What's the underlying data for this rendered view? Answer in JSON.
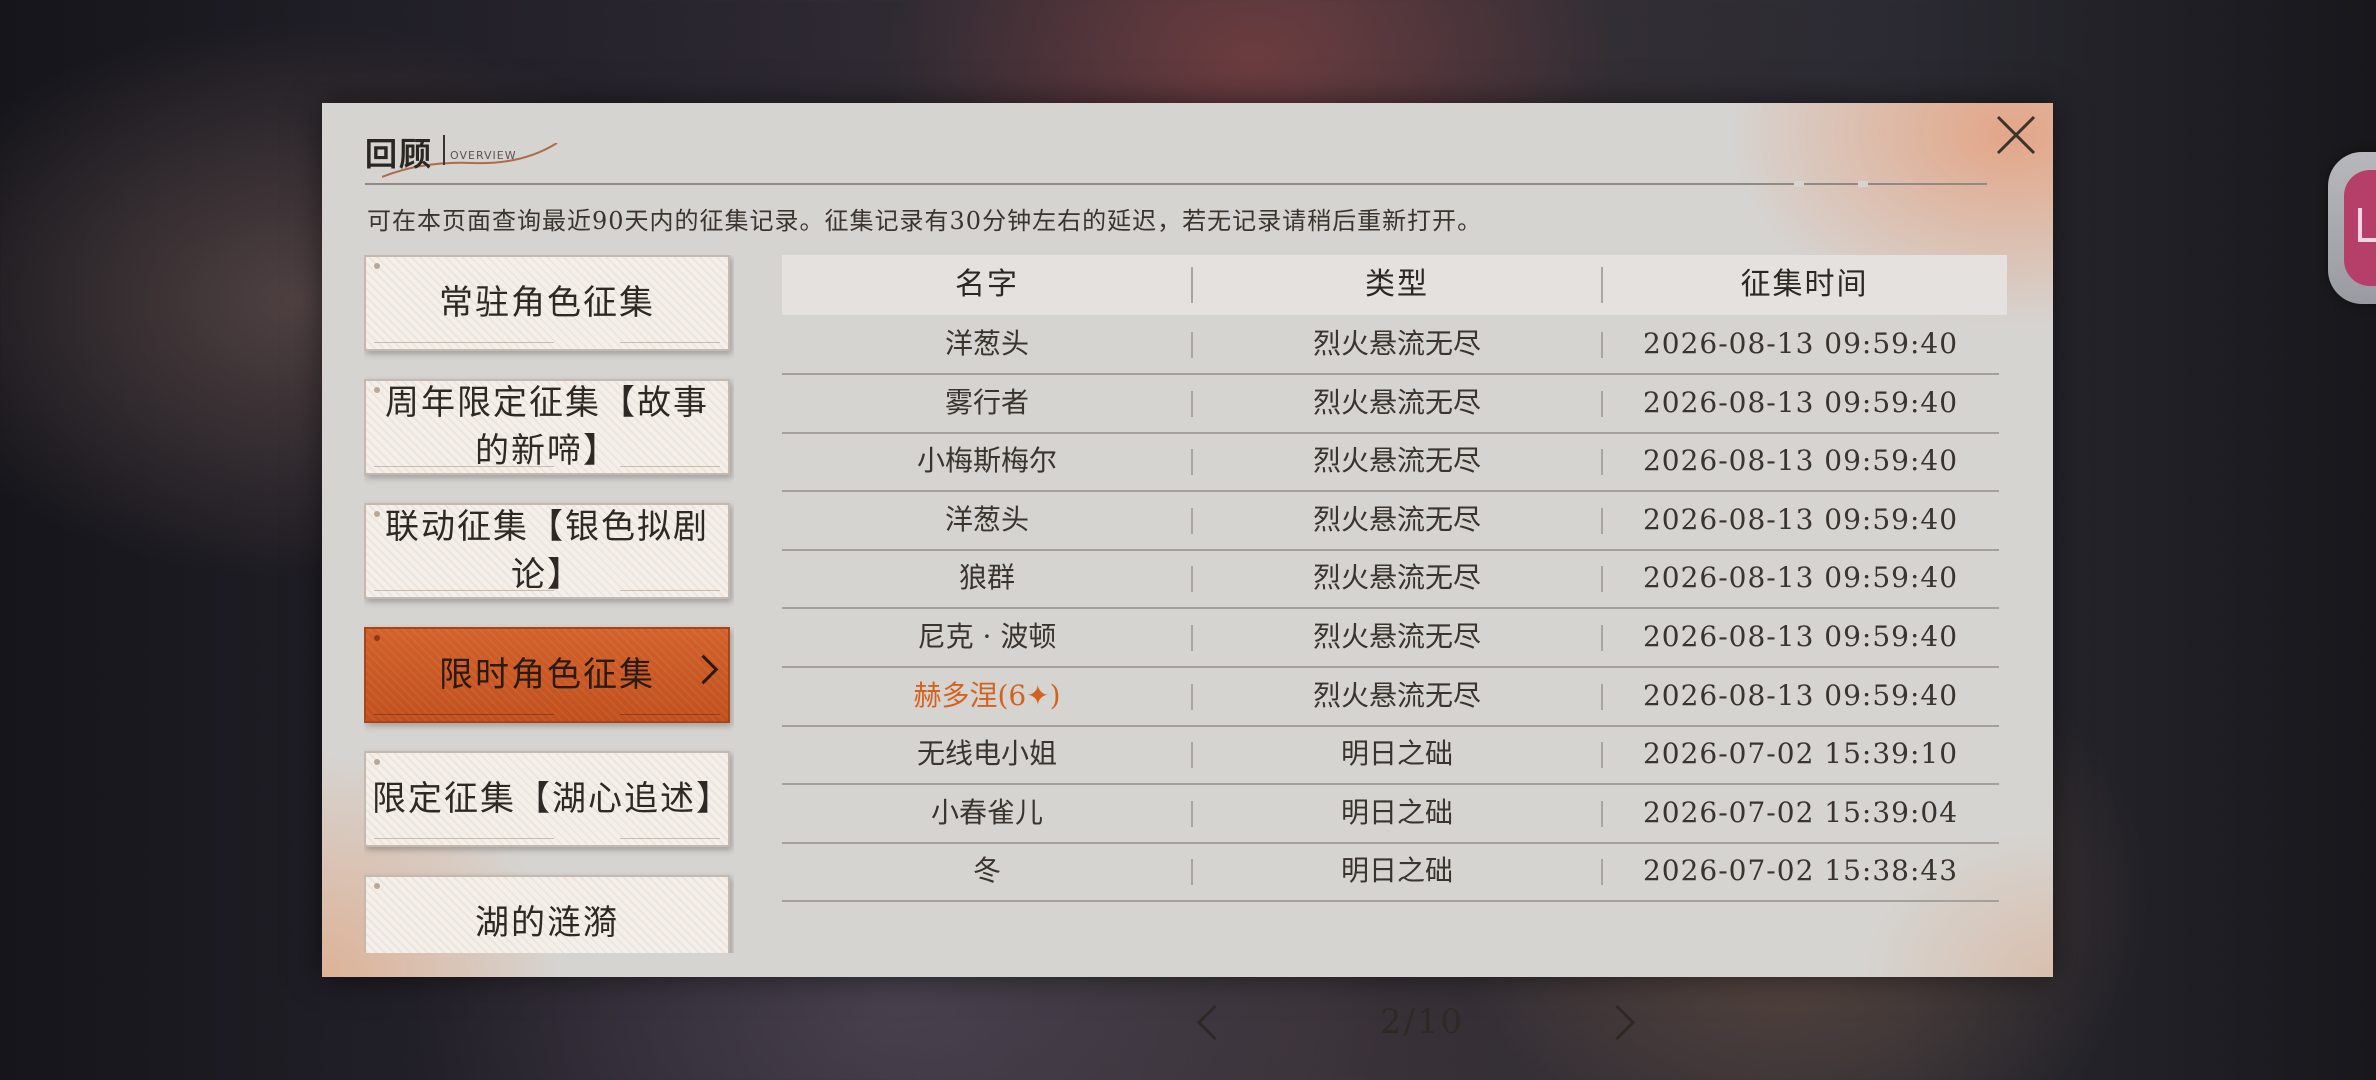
{
  "panel": {
    "title": "回顾",
    "title_sub": "OVERVIEW",
    "notice": "可在本页面查询最近90天内的征集记录。征集记录有30分钟左右的延迟，若无记录请稍后重新打开。"
  },
  "categories": [
    {
      "label": "常驻角色征集",
      "active": false
    },
    {
      "label": "周年限定征集【故事的新啼】",
      "active": false
    },
    {
      "label": "联动征集【银色拟剧论】",
      "active": false
    },
    {
      "label": "限时角色征集",
      "active": true
    },
    {
      "label": "限定征集【湖心追述】",
      "active": false
    },
    {
      "label": "湖的涟漪",
      "active": false
    }
  ],
  "table": {
    "headers": [
      "名字",
      "类型",
      "征集时间"
    ],
    "rows": [
      {
        "name": "洋葱头",
        "type": "烈火悬流无尽",
        "time": "2026-08-13 09:59:40"
      },
      {
        "name": "雾行者",
        "type": "烈火悬流无尽",
        "time": "2026-08-13 09:59:40"
      },
      {
        "name": "小梅斯梅尔",
        "type": "烈火悬流无尽",
        "time": "2026-08-13 09:59:40"
      },
      {
        "name": "洋葱头",
        "type": "烈火悬流无尽",
        "time": "2026-08-13 09:59:40"
      },
      {
        "name": "狼群",
        "type": "烈火悬流无尽",
        "time": "2026-08-13 09:59:40"
      },
      {
        "name": "尼克 · 波顿",
        "type": "烈火悬流无尽",
        "time": "2026-08-13 09:59:40"
      },
      {
        "name": "赫多涅(6✦)",
        "type": "烈火悬流无尽",
        "time": "2026-08-13 09:59:40",
        "highlight": true
      },
      {
        "name": "无线电小姐",
        "type": "明日之础",
        "time": "2026-07-02 15:39:10"
      },
      {
        "name": "小春雀儿",
        "type": "明日之础",
        "time": "2026-07-02 15:39:04"
      },
      {
        "name": "冬",
        "type": "明日之础",
        "time": "2026-07-02 15:38:43"
      }
    ]
  },
  "pager": {
    "text": "2/10"
  },
  "colors": {
    "accent": "#c9571f",
    "highlight_text": "#d2631f",
    "panel_bg": "#d6d4d1"
  }
}
